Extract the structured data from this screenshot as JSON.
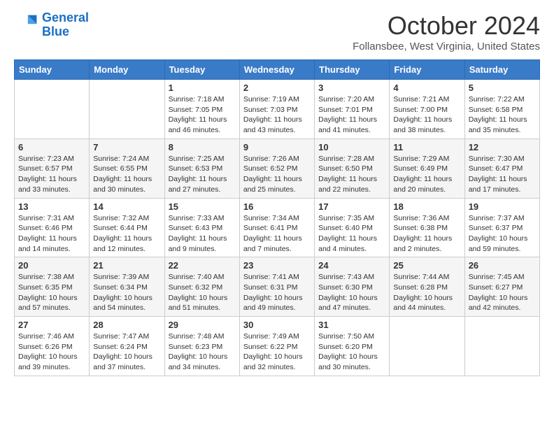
{
  "logo": {
    "line1": "General",
    "line2": "Blue"
  },
  "title": "October 2024",
  "location": "Follansbee, West Virginia, United States",
  "days_of_week": [
    "Sunday",
    "Monday",
    "Tuesday",
    "Wednesday",
    "Thursday",
    "Friday",
    "Saturday"
  ],
  "weeks": [
    [
      {
        "day": "",
        "info": ""
      },
      {
        "day": "",
        "info": ""
      },
      {
        "day": "1",
        "info": "Sunrise: 7:18 AM\nSunset: 7:05 PM\nDaylight: 11 hours and 46 minutes."
      },
      {
        "day": "2",
        "info": "Sunrise: 7:19 AM\nSunset: 7:03 PM\nDaylight: 11 hours and 43 minutes."
      },
      {
        "day": "3",
        "info": "Sunrise: 7:20 AM\nSunset: 7:01 PM\nDaylight: 11 hours and 41 minutes."
      },
      {
        "day": "4",
        "info": "Sunrise: 7:21 AM\nSunset: 7:00 PM\nDaylight: 11 hours and 38 minutes."
      },
      {
        "day": "5",
        "info": "Sunrise: 7:22 AM\nSunset: 6:58 PM\nDaylight: 11 hours and 35 minutes."
      }
    ],
    [
      {
        "day": "6",
        "info": "Sunrise: 7:23 AM\nSunset: 6:57 PM\nDaylight: 11 hours and 33 minutes."
      },
      {
        "day": "7",
        "info": "Sunrise: 7:24 AM\nSunset: 6:55 PM\nDaylight: 11 hours and 30 minutes."
      },
      {
        "day": "8",
        "info": "Sunrise: 7:25 AM\nSunset: 6:53 PM\nDaylight: 11 hours and 27 minutes."
      },
      {
        "day": "9",
        "info": "Sunrise: 7:26 AM\nSunset: 6:52 PM\nDaylight: 11 hours and 25 minutes."
      },
      {
        "day": "10",
        "info": "Sunrise: 7:28 AM\nSunset: 6:50 PM\nDaylight: 11 hours and 22 minutes."
      },
      {
        "day": "11",
        "info": "Sunrise: 7:29 AM\nSunset: 6:49 PM\nDaylight: 11 hours and 20 minutes."
      },
      {
        "day": "12",
        "info": "Sunrise: 7:30 AM\nSunset: 6:47 PM\nDaylight: 11 hours and 17 minutes."
      }
    ],
    [
      {
        "day": "13",
        "info": "Sunrise: 7:31 AM\nSunset: 6:46 PM\nDaylight: 11 hours and 14 minutes."
      },
      {
        "day": "14",
        "info": "Sunrise: 7:32 AM\nSunset: 6:44 PM\nDaylight: 11 hours and 12 minutes."
      },
      {
        "day": "15",
        "info": "Sunrise: 7:33 AM\nSunset: 6:43 PM\nDaylight: 11 hours and 9 minutes."
      },
      {
        "day": "16",
        "info": "Sunrise: 7:34 AM\nSunset: 6:41 PM\nDaylight: 11 hours and 7 minutes."
      },
      {
        "day": "17",
        "info": "Sunrise: 7:35 AM\nSunset: 6:40 PM\nDaylight: 11 hours and 4 minutes."
      },
      {
        "day": "18",
        "info": "Sunrise: 7:36 AM\nSunset: 6:38 PM\nDaylight: 11 hours and 2 minutes."
      },
      {
        "day": "19",
        "info": "Sunrise: 7:37 AM\nSunset: 6:37 PM\nDaylight: 10 hours and 59 minutes."
      }
    ],
    [
      {
        "day": "20",
        "info": "Sunrise: 7:38 AM\nSunset: 6:35 PM\nDaylight: 10 hours and 57 minutes."
      },
      {
        "day": "21",
        "info": "Sunrise: 7:39 AM\nSunset: 6:34 PM\nDaylight: 10 hours and 54 minutes."
      },
      {
        "day": "22",
        "info": "Sunrise: 7:40 AM\nSunset: 6:32 PM\nDaylight: 10 hours and 51 minutes."
      },
      {
        "day": "23",
        "info": "Sunrise: 7:41 AM\nSunset: 6:31 PM\nDaylight: 10 hours and 49 minutes."
      },
      {
        "day": "24",
        "info": "Sunrise: 7:43 AM\nSunset: 6:30 PM\nDaylight: 10 hours and 47 minutes."
      },
      {
        "day": "25",
        "info": "Sunrise: 7:44 AM\nSunset: 6:28 PM\nDaylight: 10 hours and 44 minutes."
      },
      {
        "day": "26",
        "info": "Sunrise: 7:45 AM\nSunset: 6:27 PM\nDaylight: 10 hours and 42 minutes."
      }
    ],
    [
      {
        "day": "27",
        "info": "Sunrise: 7:46 AM\nSunset: 6:26 PM\nDaylight: 10 hours and 39 minutes."
      },
      {
        "day": "28",
        "info": "Sunrise: 7:47 AM\nSunset: 6:24 PM\nDaylight: 10 hours and 37 minutes."
      },
      {
        "day": "29",
        "info": "Sunrise: 7:48 AM\nSunset: 6:23 PM\nDaylight: 10 hours and 34 minutes."
      },
      {
        "day": "30",
        "info": "Sunrise: 7:49 AM\nSunset: 6:22 PM\nDaylight: 10 hours and 32 minutes."
      },
      {
        "day": "31",
        "info": "Sunrise: 7:50 AM\nSunset: 6:20 PM\nDaylight: 10 hours and 30 minutes."
      },
      {
        "day": "",
        "info": ""
      },
      {
        "day": "",
        "info": ""
      }
    ]
  ]
}
